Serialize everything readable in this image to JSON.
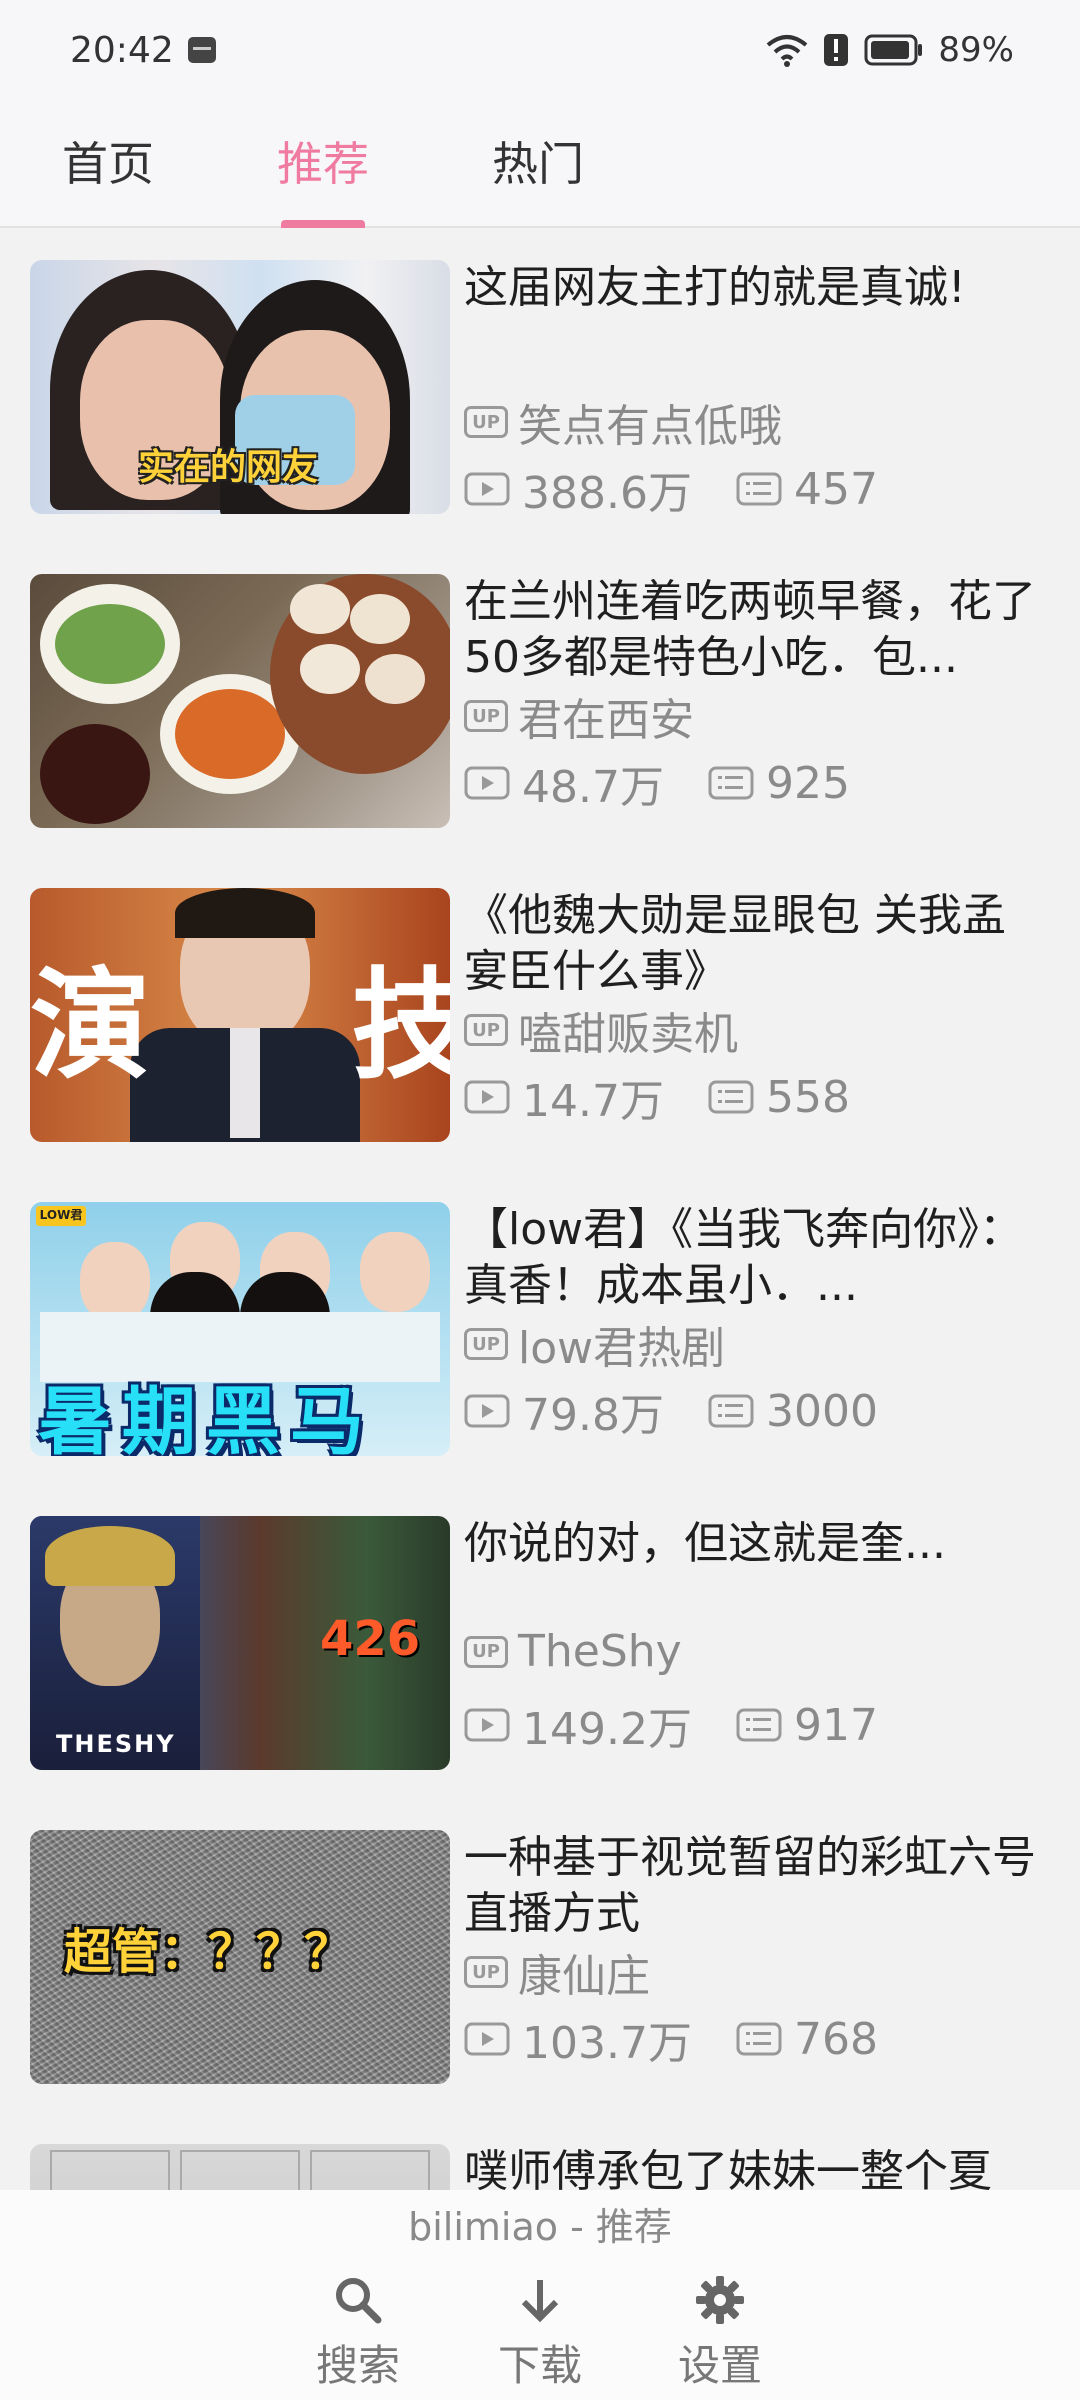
{
  "status": {
    "time": "20:42",
    "battery": "89%"
  },
  "tabs": [
    {
      "label": "首页",
      "active": false
    },
    {
      "label": "推荐",
      "active": true
    },
    {
      "label": "热门",
      "active": false
    }
  ],
  "videos": [
    {
      "title": "这届网友主打的就是真诚!",
      "author": "笑点有点低哦",
      "views": "388.6万",
      "danmaku": "457",
      "thumb_text": "实在的网友"
    },
    {
      "title": "在兰州连着吃两顿早餐，花了50多都是特色小吃．包...",
      "author": "君在西安",
      "views": "48.7万",
      "danmaku": "925",
      "thumb_text": ""
    },
    {
      "title": "《他魏大勋是显眼包 关我孟宴臣什么事》",
      "author": "嗑甜贩卖机",
      "views": "14.7万",
      "danmaku": "558",
      "thumb_text": "演 技"
    },
    {
      "title": "【low君】《当我飞奔向你》：真香！成本虽小．...",
      "author": "low君热剧",
      "views": "79.8万",
      "danmaku": "3000",
      "thumb_text": "暑期黑马"
    },
    {
      "title": "你说的对，但这就是奎...",
      "author": "TheShy",
      "views": "149.2万",
      "danmaku": "917",
      "thumb_text": "THESHY"
    },
    {
      "title": "一种基于视觉暂留的彩虹六号直播方式",
      "author": "康仙庄",
      "views": "103.7万",
      "danmaku": "768",
      "thumb_text": "超管：？？？"
    },
    {
      "title": "噗师傅承包了妹妹一整个夏",
      "author": "",
      "views": "",
      "danmaku": "",
      "thumb_text": ""
    }
  ],
  "thumb_extra": {
    "v5_score": "426",
    "v4_logo": "LOW君"
  },
  "bottom": {
    "app_title": "bilimiao - 推荐",
    "nav": [
      {
        "label": "搜索",
        "icon": "search-icon"
      },
      {
        "label": "下载",
        "icon": "download-icon"
      },
      {
        "label": "设置",
        "icon": "gear-icon"
      }
    ]
  },
  "colors": {
    "accent": "#ef7ba0"
  }
}
